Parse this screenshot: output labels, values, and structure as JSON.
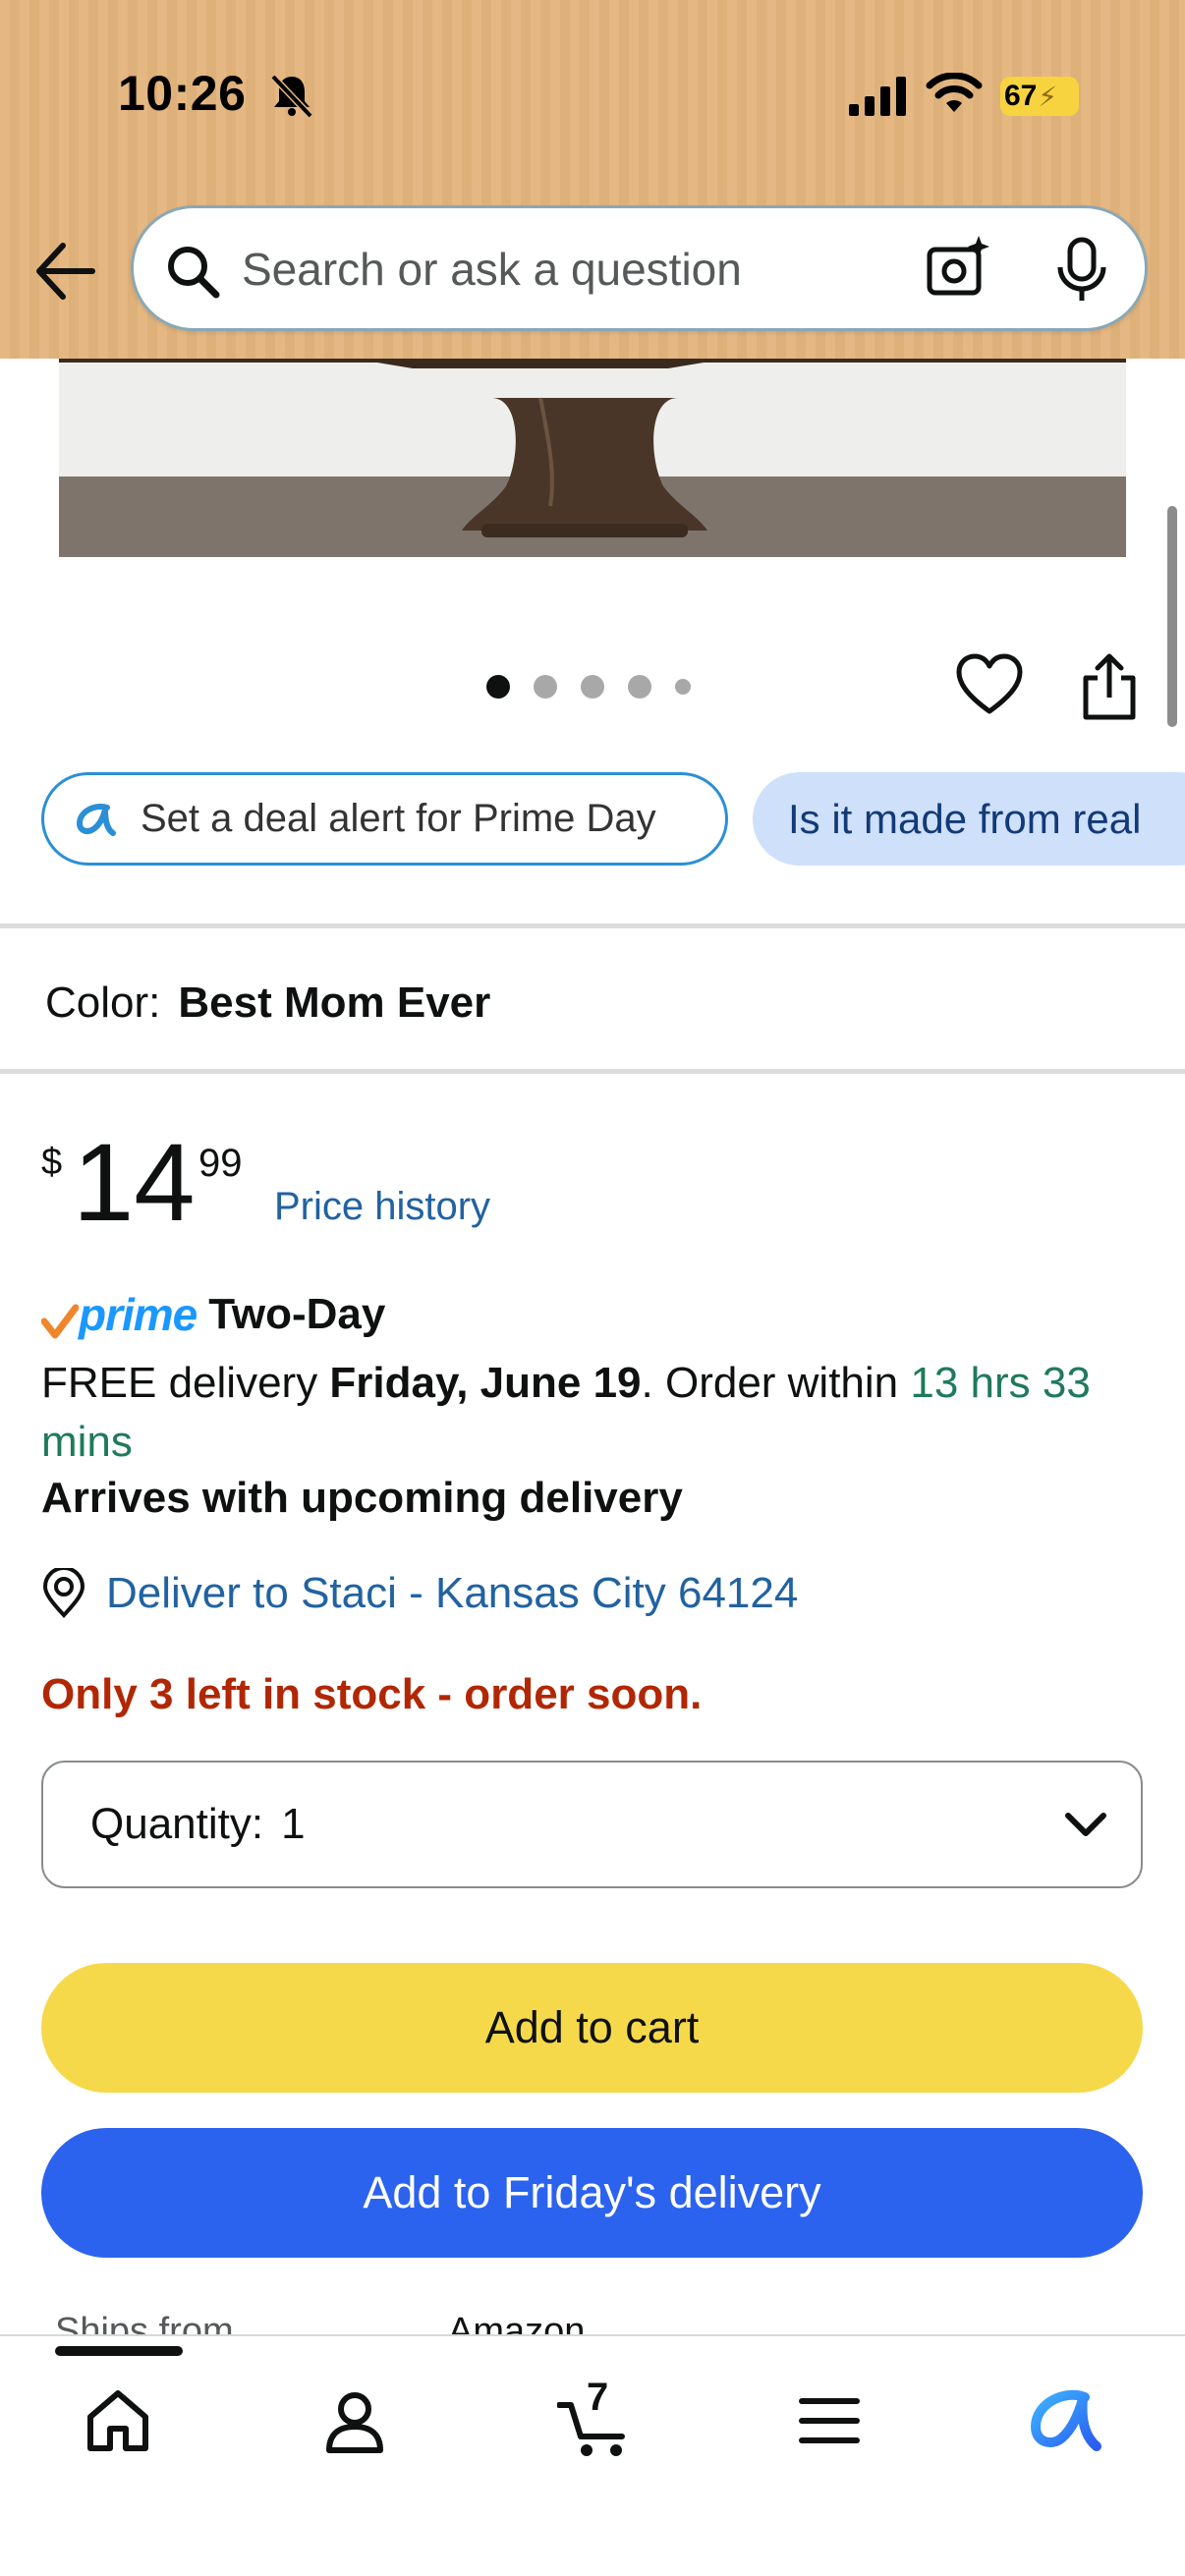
{
  "status_bar": {
    "time": "10:26",
    "battery": "67",
    "icons": [
      "bell-off-icon",
      "signal-icon",
      "wifi-icon",
      "battery-icon"
    ]
  },
  "header": {
    "search_placeholder": "Search or ask a question",
    "icons": [
      "back-arrow-icon",
      "search-icon",
      "camera-icon",
      "microphone-icon"
    ],
    "background_color": "#e5b883"
  },
  "gallery": {
    "image_count": 5,
    "active_index": 0,
    "icons": [
      "heart-icon",
      "share-icon"
    ]
  },
  "chips": {
    "deal_alert": "Set a deal alert for Prime Day",
    "question": "Is it made from real"
  },
  "color": {
    "label": "Color:",
    "value": "Best Mom Ever"
  },
  "price": {
    "currency": "$",
    "whole": "14",
    "fraction": "99",
    "history_link": "Price history"
  },
  "delivery": {
    "prime_label": "prime",
    "prime_tier": "Two-Day",
    "free_prefix": "FREE delivery ",
    "date": "Friday, June 19",
    "order_within": ". Order within ",
    "countdown": "13 hrs 33 mins",
    "arrives": "Arrives with upcoming delivery",
    "deliver_to": "Deliver to Staci - Kansas City 64124"
  },
  "stock": "Only 3 left in stock - order soon.",
  "quantity": {
    "label": "Quantity:",
    "value": "1"
  },
  "buttons": {
    "add_to_cart": "Add to cart",
    "add_to_delivery": "Add to Friday's delivery"
  },
  "ships_from": {
    "label": "Ships from",
    "value": "Amazon"
  },
  "tabbar": {
    "cart_count": "7",
    "icons": [
      "home-icon",
      "account-icon",
      "cart-icon",
      "menu-icon",
      "rufus-icon"
    ]
  },
  "colors": {
    "add_to_cart": "#f6d94a",
    "add_to_delivery": "#2b63ef",
    "stock_red": "#b12704",
    "link_blue": "#2162a1",
    "countdown_green": "#1f7a5c"
  }
}
